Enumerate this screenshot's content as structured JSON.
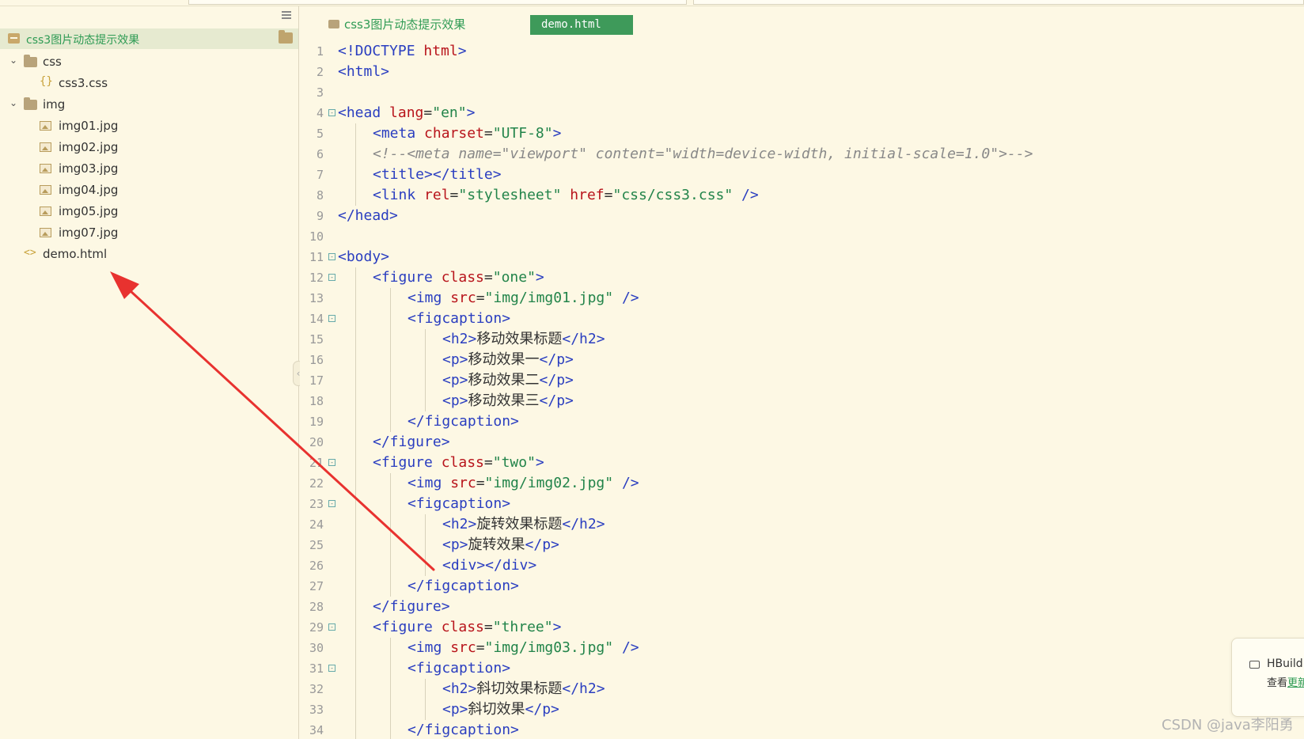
{
  "sidebar": {
    "project": "css3图片动态提示效果",
    "items": [
      {
        "type": "folder",
        "label": "css",
        "expanded": true
      },
      {
        "type": "css-file",
        "label": "css3.css"
      },
      {
        "type": "folder",
        "label": "img",
        "expanded": true
      },
      {
        "type": "image-file",
        "label": "img01.jpg"
      },
      {
        "type": "image-file",
        "label": "img02.jpg"
      },
      {
        "type": "image-file",
        "label": "img03.jpg"
      },
      {
        "type": "image-file",
        "label": "img04.jpg"
      },
      {
        "type": "image-file",
        "label": "img05.jpg"
      },
      {
        "type": "image-file",
        "label": "img07.jpg"
      },
      {
        "type": "html-file",
        "label": "demo.html"
      }
    ]
  },
  "editor": {
    "breadcrumb": "css3图片动态提示效果",
    "active_tab": "demo.html",
    "lines": [
      {
        "n": "1",
        "indent": 0,
        "fold": "",
        "tokens": [
          [
            "tg",
            "<!DOCTYPE "
          ],
          [
            "at",
            "html"
          ],
          [
            "tg",
            ">"
          ]
        ]
      },
      {
        "n": "2",
        "indent": 0,
        "fold": "",
        "tokens": [
          [
            "tg",
            "<html>"
          ]
        ]
      },
      {
        "n": "3",
        "indent": 0,
        "fold": "",
        "tokens": []
      },
      {
        "n": "4",
        "indent": 0,
        "fold": "⊟",
        "tokens": [
          [
            "tg",
            "<head "
          ],
          [
            "at",
            "lang"
          ],
          [
            "cj",
            "="
          ],
          [
            "st",
            "\"en\""
          ],
          [
            "tg",
            ">"
          ]
        ]
      },
      {
        "n": "5",
        "indent": 1,
        "fold": "",
        "tokens": [
          [
            "tg",
            "<meta "
          ],
          [
            "at",
            "charset"
          ],
          [
            "cj",
            "="
          ],
          [
            "st",
            "\"UTF-8\""
          ],
          [
            "tg",
            ">"
          ]
        ]
      },
      {
        "n": "6",
        "indent": 1,
        "fold": "",
        "tokens": [
          [
            "cm",
            "<!--<meta name=\"viewport\" content=\"width=device-width, initial-scale=1.0\">-->"
          ]
        ]
      },
      {
        "n": "7",
        "indent": 1,
        "fold": "",
        "tokens": [
          [
            "tg",
            "<title></title>"
          ]
        ]
      },
      {
        "n": "8",
        "indent": 1,
        "fold": "",
        "tokens": [
          [
            "tg",
            "<link "
          ],
          [
            "at",
            "rel"
          ],
          [
            "cj",
            "="
          ],
          [
            "st",
            "\"stylesheet\""
          ],
          [
            "cj",
            " "
          ],
          [
            "at",
            "href"
          ],
          [
            "cj",
            "="
          ],
          [
            "st",
            "\"css/css3.css\""
          ],
          [
            "tg",
            " />"
          ]
        ]
      },
      {
        "n": "9",
        "indent": 0,
        "fold": "",
        "tokens": [
          [
            "tg",
            "</head>"
          ]
        ]
      },
      {
        "n": "10",
        "indent": 0,
        "fold": "",
        "tokens": []
      },
      {
        "n": "11",
        "indent": 0,
        "fold": "⊟",
        "tokens": [
          [
            "tg",
            "<body>"
          ]
        ]
      },
      {
        "n": "12",
        "indent": 1,
        "fold": "⊟",
        "tokens": [
          [
            "tg",
            "<figure "
          ],
          [
            "at",
            "class"
          ],
          [
            "cj",
            "="
          ],
          [
            "st",
            "\"one\""
          ],
          [
            "tg",
            ">"
          ]
        ]
      },
      {
        "n": "13",
        "indent": 2,
        "fold": "",
        "tokens": [
          [
            "tg",
            "<img "
          ],
          [
            "at",
            "src"
          ],
          [
            "cj",
            "="
          ],
          [
            "st",
            "\"img/img01.jpg\""
          ],
          [
            "tg",
            " />"
          ]
        ]
      },
      {
        "n": "14",
        "indent": 2,
        "fold": "⊟",
        "tokens": [
          [
            "tg",
            "<figcaption>"
          ]
        ]
      },
      {
        "n": "15",
        "indent": 3,
        "fold": "",
        "tokens": [
          [
            "tg",
            "<h2>"
          ],
          [
            "cj",
            "移动效果标题"
          ],
          [
            "tg",
            "</h2>"
          ]
        ]
      },
      {
        "n": "16",
        "indent": 3,
        "fold": "",
        "tokens": [
          [
            "tg",
            "<p>"
          ],
          [
            "cj",
            "移动效果一"
          ],
          [
            "tg",
            "</p>"
          ]
        ]
      },
      {
        "n": "17",
        "indent": 3,
        "fold": "",
        "tokens": [
          [
            "tg",
            "<p>"
          ],
          [
            "cj",
            "移动效果二"
          ],
          [
            "tg",
            "</p>"
          ]
        ]
      },
      {
        "n": "18",
        "indent": 3,
        "fold": "",
        "tokens": [
          [
            "tg",
            "<p>"
          ],
          [
            "cj",
            "移动效果三"
          ],
          [
            "tg",
            "</p>"
          ]
        ]
      },
      {
        "n": "19",
        "indent": 2,
        "fold": "",
        "tokens": [
          [
            "tg",
            "</figcaption>"
          ]
        ]
      },
      {
        "n": "20",
        "indent": 1,
        "fold": "",
        "tokens": [
          [
            "tg",
            "</figure>"
          ]
        ]
      },
      {
        "n": "21",
        "indent": 1,
        "fold": "⊟",
        "tokens": [
          [
            "tg",
            "<figure "
          ],
          [
            "at",
            "class"
          ],
          [
            "cj",
            "="
          ],
          [
            "st",
            "\"two\""
          ],
          [
            "tg",
            ">"
          ]
        ]
      },
      {
        "n": "22",
        "indent": 2,
        "fold": "",
        "tokens": [
          [
            "tg",
            "<img "
          ],
          [
            "at",
            "src"
          ],
          [
            "cj",
            "="
          ],
          [
            "st",
            "\"img/img02.jpg\""
          ],
          [
            "tg",
            " />"
          ]
        ]
      },
      {
        "n": "23",
        "indent": 2,
        "fold": "⊟",
        "tokens": [
          [
            "tg",
            "<figcaption>"
          ]
        ]
      },
      {
        "n": "24",
        "indent": 3,
        "fold": "",
        "tokens": [
          [
            "tg",
            "<h2>"
          ],
          [
            "cj",
            "旋转效果标题"
          ],
          [
            "tg",
            "</h2>"
          ]
        ]
      },
      {
        "n": "25",
        "indent": 3,
        "fold": "",
        "tokens": [
          [
            "tg",
            "<p>"
          ],
          [
            "cj",
            "旋转效果"
          ],
          [
            "tg",
            "</p>"
          ]
        ]
      },
      {
        "n": "26",
        "indent": 3,
        "fold": "",
        "tokens": [
          [
            "tg",
            "<div></div>"
          ]
        ]
      },
      {
        "n": "27",
        "indent": 2,
        "fold": "",
        "tokens": [
          [
            "tg",
            "</figcaption>"
          ]
        ]
      },
      {
        "n": "28",
        "indent": 1,
        "fold": "",
        "tokens": [
          [
            "tg",
            "</figure>"
          ]
        ]
      },
      {
        "n": "29",
        "indent": 1,
        "fold": "⊟",
        "tokens": [
          [
            "tg",
            "<figure "
          ],
          [
            "at",
            "class"
          ],
          [
            "cj",
            "="
          ],
          [
            "st",
            "\"three\""
          ],
          [
            "tg",
            ">"
          ]
        ]
      },
      {
        "n": "30",
        "indent": 2,
        "fold": "",
        "tokens": [
          [
            "tg",
            "<img "
          ],
          [
            "at",
            "src"
          ],
          [
            "cj",
            "="
          ],
          [
            "st",
            "\"img/img03.jpg\""
          ],
          [
            "tg",
            " />"
          ]
        ]
      },
      {
        "n": "31",
        "indent": 2,
        "fold": "⊟",
        "tokens": [
          [
            "tg",
            "<figcaption>"
          ]
        ]
      },
      {
        "n": "32",
        "indent": 3,
        "fold": "",
        "tokens": [
          [
            "tg",
            "<h2>"
          ],
          [
            "cj",
            "斜切效果标题"
          ],
          [
            "tg",
            "</h2>"
          ]
        ]
      },
      {
        "n": "33",
        "indent": 3,
        "fold": "",
        "tokens": [
          [
            "tg",
            "<p>"
          ],
          [
            "cj",
            "斜切效果"
          ],
          [
            "tg",
            "</p>"
          ]
        ]
      },
      {
        "n": "34",
        "indent": 2,
        "fold": "",
        "tokens": [
          [
            "tg",
            "</figcaption>"
          ]
        ]
      }
    ]
  },
  "notification": {
    "title": "HBuild",
    "text_prefix": "查看",
    "link": "更新"
  },
  "watermark": "CSDN @java李阳勇",
  "colors": {
    "background": "#fdf8e4",
    "accent_green": "#3e9a5a",
    "tag_blue": "#2a3ec0",
    "attr_red": "#b8141b",
    "string_green": "#22844a",
    "arrow_red": "#e8322f"
  }
}
